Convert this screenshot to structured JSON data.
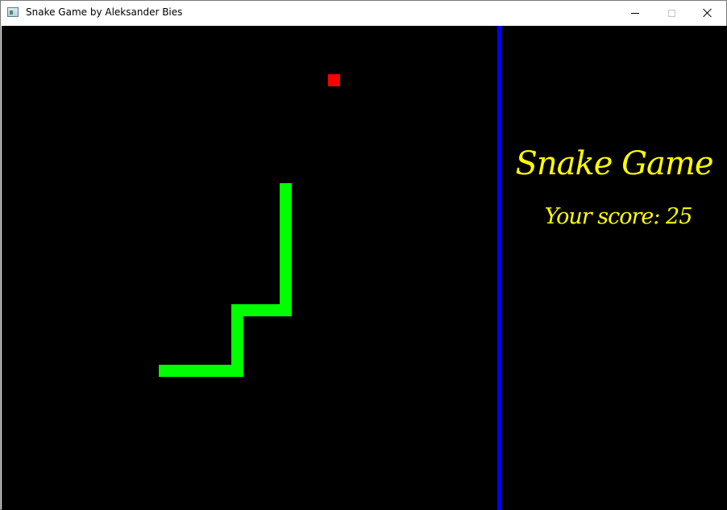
{
  "window": {
    "title": "Snake Game by Aleksander Bies",
    "minimize_icon": "minimize-icon",
    "maximize_icon": "maximize-icon",
    "close_icon": "close-icon"
  },
  "game": {
    "background_color": "#000000",
    "snake_color": "#00ff00",
    "food_color": "#ff0000",
    "divider_color": "#0000ff"
  },
  "sidebar": {
    "title": "Snake Game",
    "score_label": "Your score:",
    "score_value": "25",
    "text_color": "#ffff00"
  }
}
